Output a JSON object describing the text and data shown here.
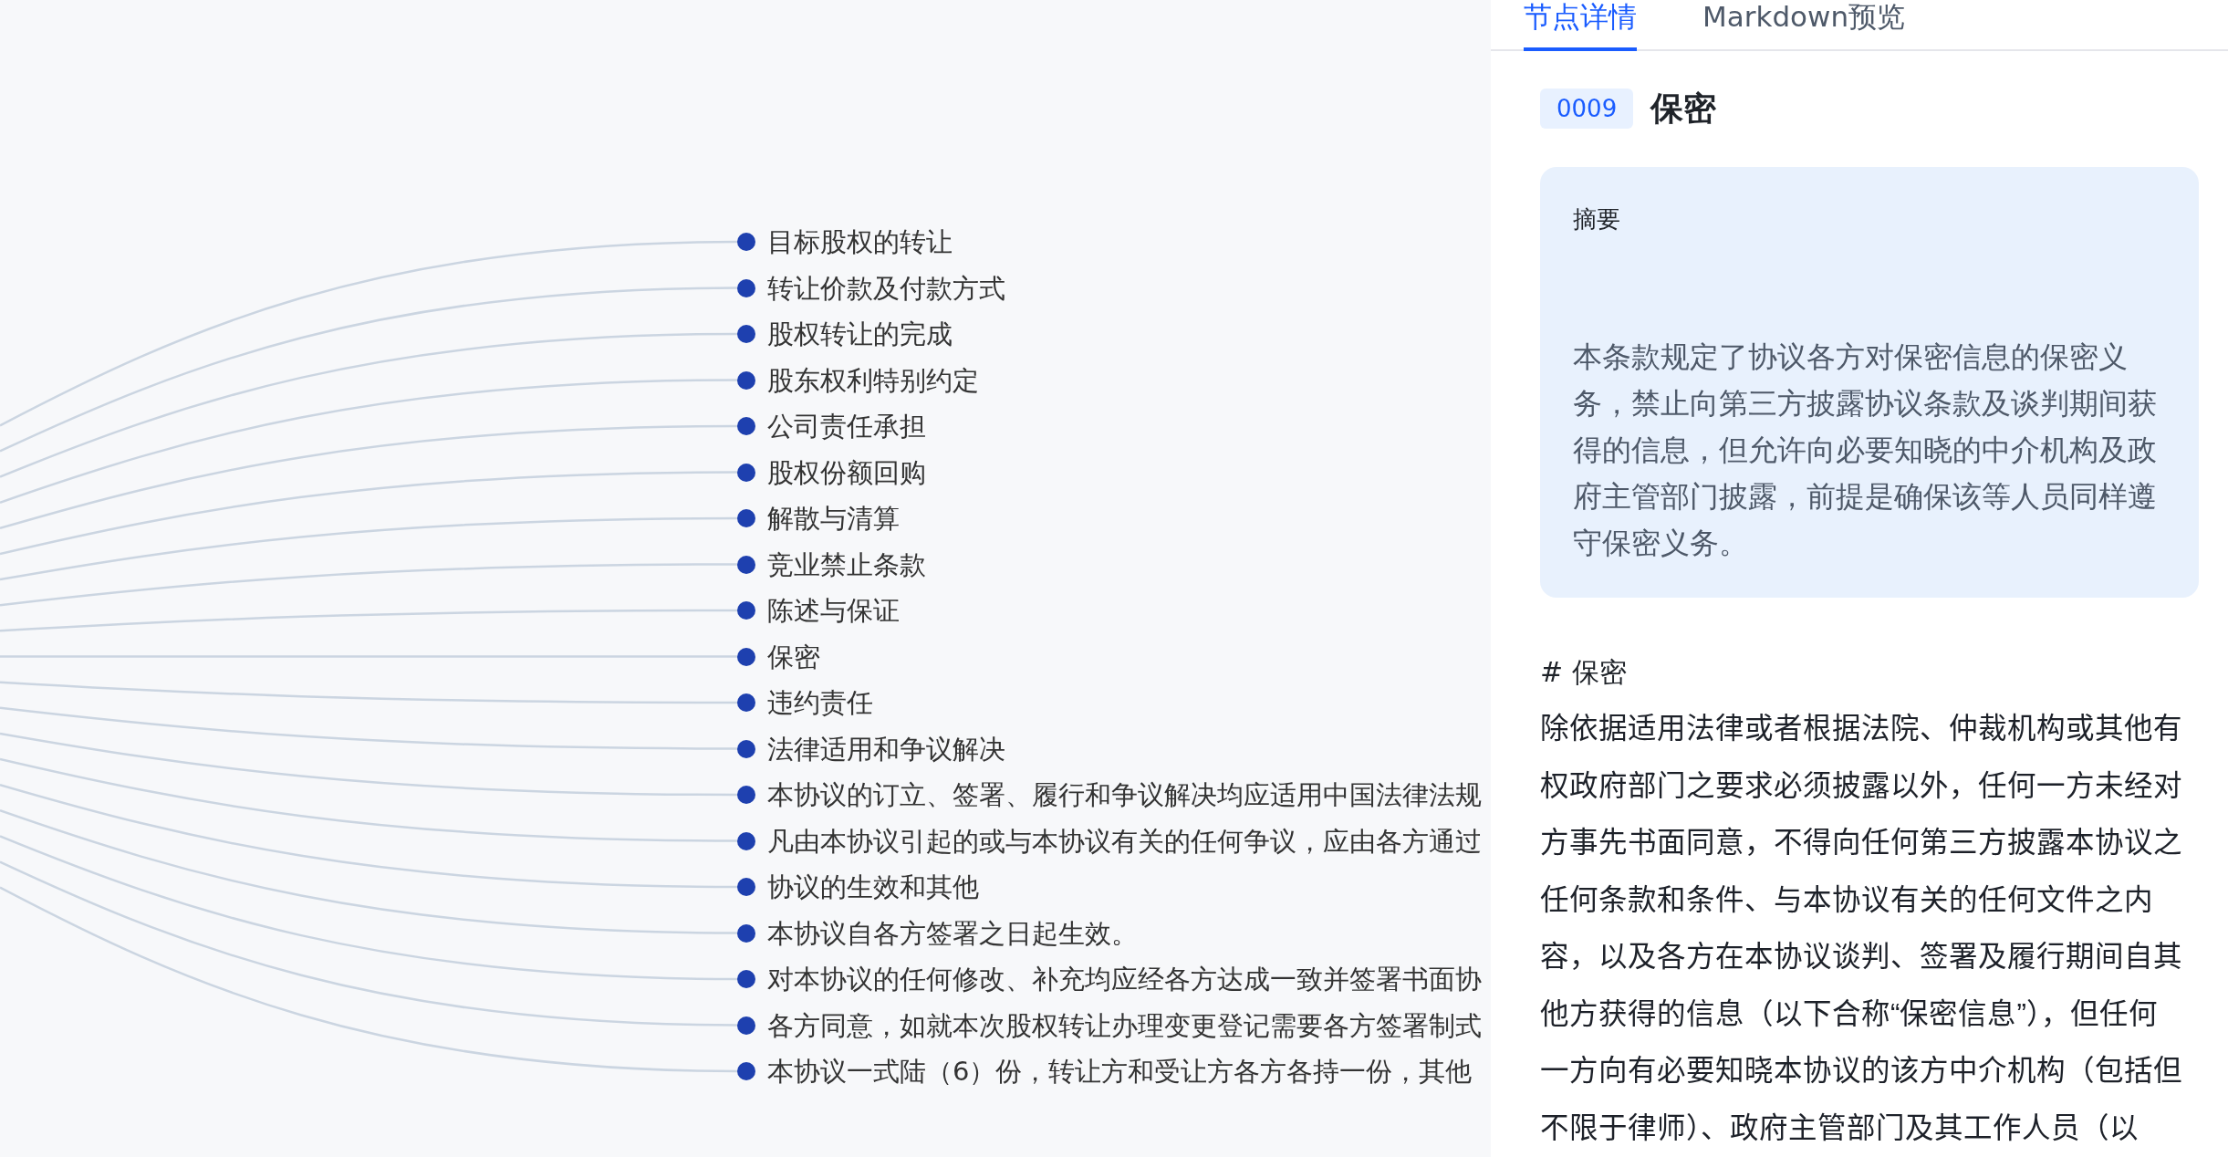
{
  "mindmap": {
    "nodes": [
      "目标股权的转让",
      "转让价款及付款方式",
      "股权转让的完成",
      "股东权利特别约定",
      "公司责任承担",
      "股权份额回购",
      "解散与清算",
      "竞业禁止条款",
      "陈述与保证",
      "保密",
      "违约责任",
      "法律适用和争议解决",
      "本协议的订立、签署、履行和争议解决均应适用中国法律法规",
      "凡由本协议引起的或与本协议有关的任何争议，应由各方通过",
      "协议的生效和其他",
      "本协议自各方签署之日起生效。",
      "对本协议的任何修改、补充均应经各方达成一致并签署书面协",
      "各方同意，如就本次股权转让办理变更登记需要各方签署制式",
      "本协议一式陆（6）份，转让方和受让方各方各持一份，其他"
    ]
  },
  "panel": {
    "tabs": [
      {
        "label": "节点详情",
        "selected": true
      },
      {
        "label": "Markdown预览",
        "selected": false
      }
    ],
    "node": {
      "code": "0009",
      "title": "保密"
    },
    "summary": {
      "label": "摘要",
      "text": "本条款规定了协议各方对保密信息的保密义务，禁止向第三方披露协议条款及谈判期间获得的信息，但允许向必要知晓的中介机构及政府主管部门披露，前提是确保该等人员同样遵守保密义务。"
    },
    "markdown": {
      "heading": "# 保密",
      "body": "除依据适用法律或者根据法院、仲裁机构或其他有权政府部门之要求必须披露以外，任何一方未经对方事先书面同意，不得向任何第三方披露本协议之任何条款和条件、与本协议有关的任何文件之内容，以及各方在本协议谈判、签署及履行期间自其他方获得的信息（以下合称“保密信息”），但任何一方向有必要知晓本协议的该方中介机构（包括但不限于律师）、政府主管部门及其工作人员（以"
    }
  }
}
